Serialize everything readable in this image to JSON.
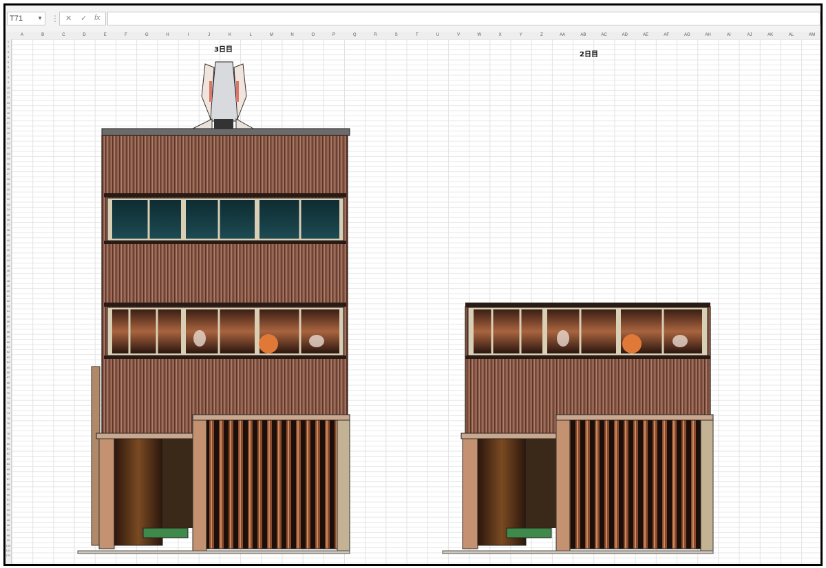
{
  "namebox": {
    "value": "T71"
  },
  "formula": {
    "cancel_icon": "✕",
    "confirm_icon": "✓",
    "fx_label": "fx",
    "value": ""
  },
  "columns": [
    "A",
    "B",
    "C",
    "D",
    "E",
    "F",
    "G",
    "H",
    "I",
    "J",
    "K",
    "L",
    "M",
    "N",
    "O",
    "P",
    "Q",
    "R",
    "S",
    "T",
    "U",
    "V",
    "W",
    "X",
    "Y",
    "Z",
    "AA",
    "AB",
    "AC",
    "AD",
    "AE",
    "AF",
    "AG",
    "AH",
    "AI",
    "AJ",
    "AK",
    "AL",
    "AM"
  ],
  "rows": [
    "1",
    "2",
    "3",
    "4",
    "5",
    "6",
    "7",
    "8",
    "9",
    "10",
    "11",
    "12",
    "13",
    "14",
    "15",
    "16",
    "17",
    "18",
    "19",
    "20",
    "21",
    "22",
    "23",
    "24",
    "25",
    "26",
    "27",
    "28",
    "29",
    "30",
    "31",
    "32",
    "33",
    "34",
    "35",
    "36",
    "37",
    "38",
    "39",
    "40",
    "41",
    "42",
    "43",
    "44",
    "45",
    "46",
    "47",
    "48",
    "49",
    "50",
    "51",
    "52",
    "53",
    "54",
    "55",
    "56",
    "57",
    "58",
    "59",
    "60",
    "61",
    "62",
    "63",
    "64",
    "65",
    "66",
    "67",
    "68",
    "69",
    "70",
    "71",
    "72",
    "73",
    "74",
    "75",
    "76",
    "77",
    "78",
    "79",
    "80",
    "81",
    "82",
    "83",
    "84",
    "85",
    "86",
    "87",
    "88",
    "89",
    "90",
    "91",
    "92",
    "93",
    "94",
    "95",
    "96",
    "97",
    "98",
    "99",
    "100",
    "101",
    "102"
  ],
  "labels": {
    "day3": "3日目",
    "day2": "2日目"
  },
  "colors": {
    "wall": "#8a5a48",
    "wall_dark": "#5a3528",
    "window_teal": "#123a40",
    "window_warm": "#7a4a38",
    "roof": "#6a6a6a",
    "mat": "#3f8a4a"
  }
}
